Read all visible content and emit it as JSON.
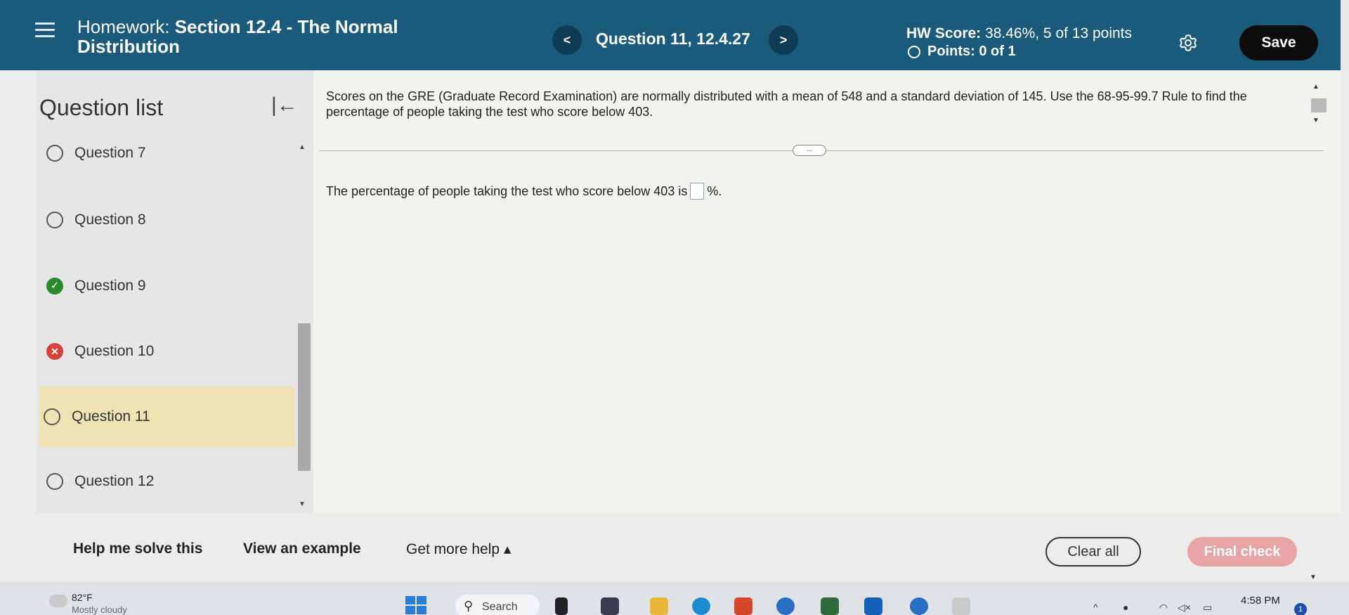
{
  "header": {
    "title_lead": "Homework:",
    "title_rest": "Section 12.4 - The Normal Distribution",
    "prev_label": "<",
    "question_title": "Question 11, 12.4.27",
    "next_label": ">",
    "hw_score_label": "HW Score:",
    "hw_score_value": "38.46%, 5 of 13 points",
    "points_text": "Points: 0 of 1",
    "save_label": "Save"
  },
  "sidebar": {
    "title": "Question list",
    "collapse_glyph": "|←",
    "items": [
      {
        "label": "Question 7",
        "status": "empty"
      },
      {
        "label": "Question 8",
        "status": "empty"
      },
      {
        "label": "Question 9",
        "status": "correct"
      },
      {
        "label": "Question 10",
        "status": "wrong"
      },
      {
        "label": "Question 11",
        "status": "empty"
      },
      {
        "label": "Question 12",
        "status": "empty"
      }
    ]
  },
  "main": {
    "question_text": "Scores on the GRE (Graduate Record Examination) are normally distributed with a mean of 548 and a standard deviation of 145. Use the 68-95-99.7 Rule to find the percentage of people taking the test who score below 403.",
    "more_label": "...",
    "answer_prefix": "The percentage of people taking the test who score below 403 is",
    "answer_suffix": "%."
  },
  "footer": {
    "help_solve": "Help me solve this",
    "view_example": "View an example",
    "more_help": "Get more help ▴",
    "clear_all": "Clear all",
    "final_check": "Final check"
  },
  "taskbar": {
    "temperature": "82°F",
    "condition": "Mostly cloudy",
    "search_label": "Search",
    "time": "4:58 PM",
    "notification_count": "1"
  },
  "colors": {
    "header_bg": "#1a5a7a",
    "active_item_bg": "#efe3b4",
    "correct_green": "#2b8a2b",
    "wrong_red": "#d6433a",
    "final_check_bg": "#e8a4a4"
  }
}
